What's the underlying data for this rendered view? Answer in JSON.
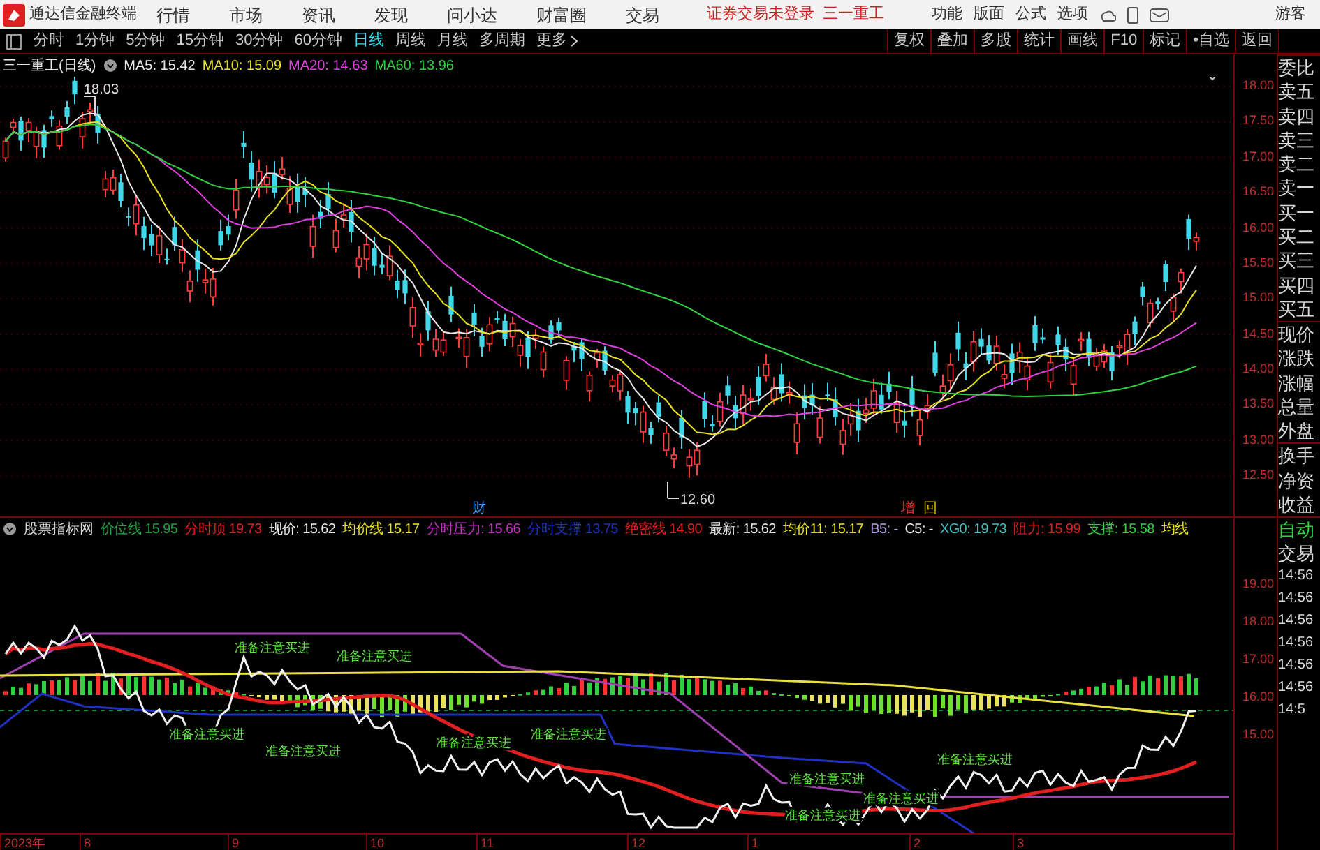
{
  "title_bar": {
    "app_name": "通达信金融终端",
    "menu": [
      "行情",
      "市场",
      "资讯",
      "发现",
      "问小达",
      "财富圈",
      "交易"
    ],
    "login_notice": "证券交易未登录",
    "stock_name": "三一重工",
    "tools": [
      "功能",
      "版面",
      "公式",
      "选项"
    ],
    "user": "游客"
  },
  "toolbar": {
    "periods": [
      {
        "label": "分时",
        "selected": false
      },
      {
        "label": "1分钟",
        "selected": false
      },
      {
        "label": "5分钟",
        "selected": false
      },
      {
        "label": "15分钟",
        "selected": false
      },
      {
        "label": "30分钟",
        "selected": false
      },
      {
        "label": "60分钟",
        "selected": false
      },
      {
        "label": "日线",
        "selected": true
      },
      {
        "label": "周线",
        "selected": false
      },
      {
        "label": "月线",
        "selected": false
      },
      {
        "label": "多周期",
        "selected": false
      },
      {
        "label": "更多",
        "selected": false
      }
    ],
    "actions": [
      "复权",
      "叠加",
      "多股",
      "统计",
      "画线",
      "F10",
      "标记",
      "•自选",
      "返回"
    ]
  },
  "main_chart": {
    "title": "三一重工(日线)",
    "ma": [
      {
        "label": "MA5: 15.42",
        "color": "#e8e8e8"
      },
      {
        "label": "MA10: 15.09",
        "color": "#e8e020"
      },
      {
        "label": "MA20: 14.63",
        "color": "#e040e0"
      },
      {
        "label": "MA60: 13.96",
        "color": "#30d040"
      }
    ],
    "high_label": "18.03",
    "low_label": "12.60",
    "markers": [
      {
        "text": "财",
        "color": "#3aa0ff"
      },
      {
        "text": "增",
        "color": "#ff3030"
      },
      {
        "text": "回",
        "color": "#e0c000"
      }
    ],
    "price_axis": [
      "18.00",
      "17.50",
      "17.00",
      "16.50",
      "16.00",
      "15.50",
      "15.00",
      "14.50",
      "14.00",
      "13.50",
      "13.00",
      "12.50"
    ]
  },
  "indicator": {
    "name": "股票指标网",
    "values": [
      {
        "label": "价位线",
        "value": "15.95",
        "color": "#20a040"
      },
      {
        "label": "分时顶",
        "value": "19.73",
        "color": "#e02020"
      },
      {
        "label": "现价:",
        "value": "15.62",
        "color": "#e8e8e8"
      },
      {
        "label": "均价线",
        "value": "15.17",
        "color": "#e8e020"
      },
      {
        "label": "分时压力:",
        "value": "15.66",
        "color": "#c030c0"
      },
      {
        "label": "分时支撑",
        "value": "13.75",
        "color": "#2030c0"
      },
      {
        "label": "绝密线",
        "value": "14.90",
        "color": "#e02020"
      },
      {
        "label": "最新:",
        "value": "15.62",
        "color": "#e8e8e8"
      },
      {
        "label": "均价11:",
        "value": "15.17",
        "color": "#e8e020"
      },
      {
        "label": "B5:",
        "value": "-",
        "color": "#b0a0e0"
      },
      {
        "label": "C5:",
        "value": "-",
        "color": "#e8e8e8"
      },
      {
        "label": "XG0:",
        "value": "19.73",
        "color": "#40c0c0"
      },
      {
        "label": "阻力:",
        "value": "15.99",
        "color": "#e02020"
      },
      {
        "label": "支撑:",
        "value": "15.58",
        "color": "#30d040"
      },
      {
        "label": "均线",
        "color": "#e8e020"
      }
    ],
    "signals": [
      "准备注意买进",
      "准备注意买进",
      "准备注意买进",
      "准备注意买进",
      "准备注意买进",
      "准备注意买进",
      "准备注意买进",
      "准备注意买进",
      "准备注意买进",
      "准备注意买进"
    ],
    "axis": [
      "19.00",
      "18.00",
      "17.00",
      "16.00",
      "15.00"
    ]
  },
  "x_axis": [
    "2023年",
    "8",
    "9",
    "10",
    "11",
    "12",
    "1",
    "2",
    "3"
  ],
  "side_panel": {
    "quote_labels": [
      "委比",
      "卖五",
      "卖四",
      "卖三",
      "卖二",
      "卖一",
      "买一",
      "买二",
      "买三",
      "买四",
      "买五",
      "现价",
      "涨跌",
      "涨幅",
      "总量",
      "外盘",
      "换手",
      "净资",
      "收益"
    ],
    "trade_labels": [
      "自动",
      "交易"
    ],
    "times": [
      "14:56",
      "14:56",
      "14:56",
      "14:56",
      "14:56",
      "14:56",
      "14:5"
    ]
  }
}
